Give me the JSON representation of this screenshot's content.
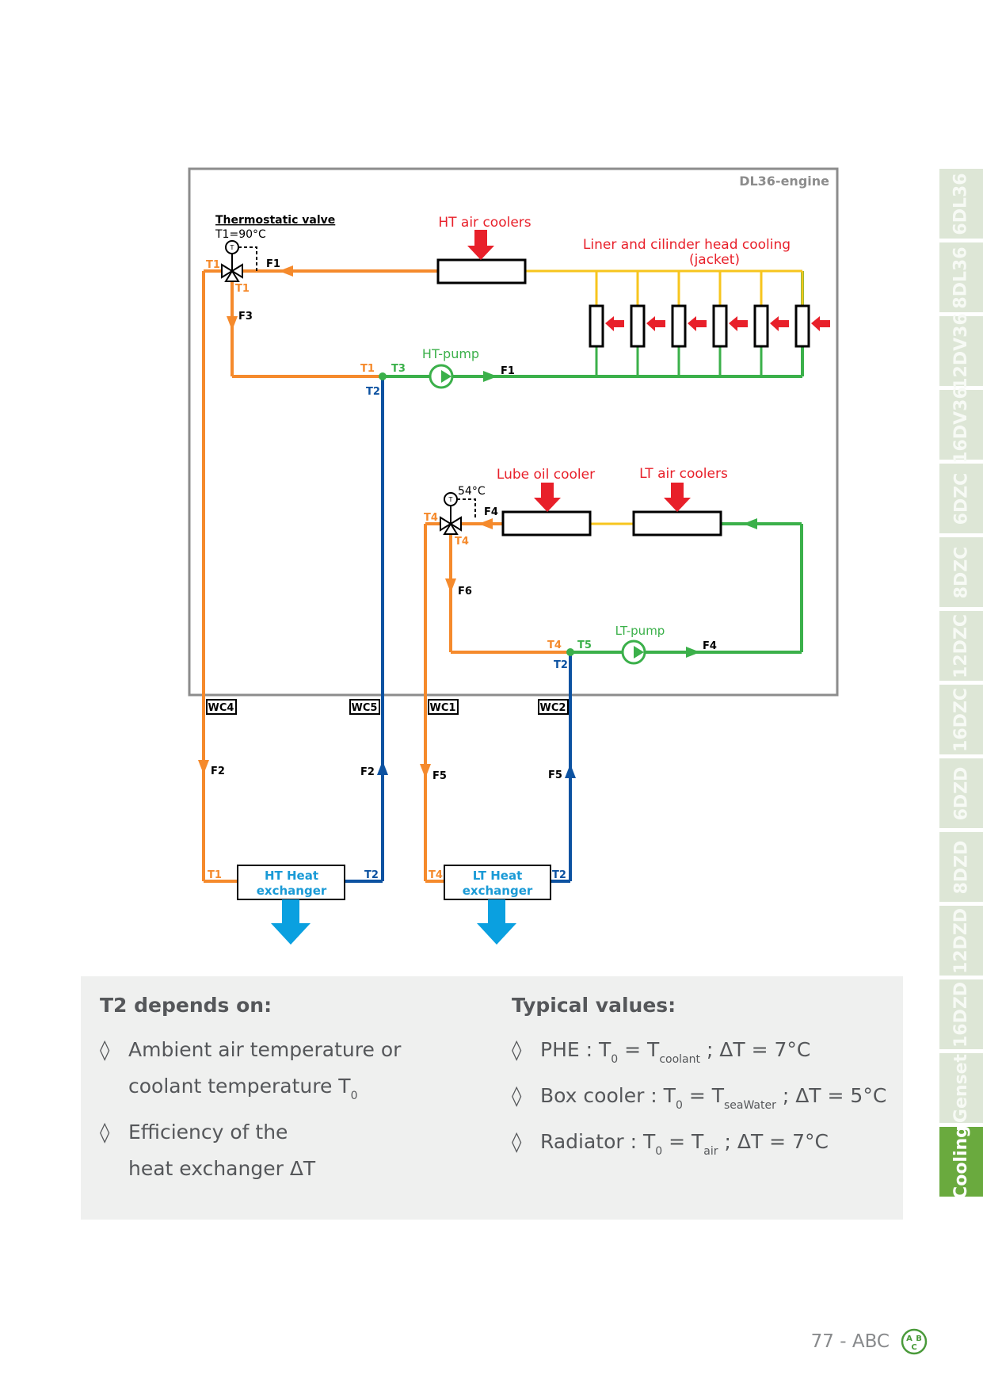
{
  "diagram": {
    "engine_label": "DL36-engine",
    "ht_circuit": {
      "thermostatic_valve_title": "Thermostatic valve",
      "thermostatic_valve_setpoint": "T1=90°C",
      "sensor_symbol": "T",
      "ht_air_coolers": "HT air coolers",
      "jacket_title": "Liner and cilinder head cooling",
      "jacket_subtitle": "(jacket)",
      "jacket_cylinder_count": 6,
      "pump_label": "HT-pump",
      "labels": {
        "t1_valve_left": "T1",
        "t1_valve_bottom": "T1",
        "f1_valve": "F1",
        "f3": "F3",
        "t1_junction": "T1",
        "t3": "T3",
        "t2_junction": "T2",
        "f1_pump": "F1"
      }
    },
    "lt_circuit": {
      "valve_setpoint": "54°C",
      "sensor_symbol": "T",
      "lube_oil_cooler": "Lube oil cooler",
      "lt_air_coolers": "LT air coolers",
      "pump_label": "LT-pump",
      "labels": {
        "t4_valve_left": "T4",
        "t4_valve_bottom": "T4",
        "f4_valve": "F4",
        "f6": "F6",
        "t4_junction": "T4",
        "t5": "T5",
        "t2_junction": "T2",
        "f4_pump": "F4"
      }
    },
    "connections": [
      "WC4",
      "WC5",
      "WC1",
      "WC2"
    ],
    "external": {
      "f2_out": "F2",
      "f2_in": "F2",
      "f5_out": "F5",
      "f5_in": "F5",
      "ht_hx_title": "HT Heat",
      "ht_hx_subtitle": "exchanger",
      "ht_hx_t1": "T1",
      "ht_hx_t2": "T2",
      "lt_hx_title": "LT Heat",
      "lt_hx_subtitle": "exchanger",
      "lt_hx_t4": "T4",
      "lt_hx_t2": "T2"
    },
    "colors": {
      "hot": "#f58a2c",
      "cold": "#0c52a1",
      "warm": "#f7c51e",
      "return": "#3bb04a",
      "heat_arrow": "#e8202a",
      "exchanger_arrow": "#0aa0e0",
      "engine_box": "#8c8c8c",
      "label_red": "#e8202a",
      "label_green": "#3bb04a",
      "label_blue": "#1a9ad6"
    }
  },
  "sidebar": {
    "tabs": [
      {
        "label": "6DL36",
        "active": false
      },
      {
        "label": "8DL36",
        "active": false
      },
      {
        "label": "12DV36",
        "active": false
      },
      {
        "label": "16DV36",
        "active": false
      },
      {
        "label": "6DZC",
        "active": false
      },
      {
        "label": "8DZC",
        "active": false
      },
      {
        "label": "12DZC",
        "active": false
      },
      {
        "label": "16DZC",
        "active": false
      },
      {
        "label": "6DZD",
        "active": false
      },
      {
        "label": "8DZD",
        "active": false
      },
      {
        "label": "12DZD",
        "active": false
      },
      {
        "label": "16DZD",
        "active": false
      },
      {
        "label": "Genset",
        "active": false
      },
      {
        "label": "Cooling",
        "active": true
      }
    ]
  },
  "info": {
    "left": {
      "title": "T2 depends on:",
      "bullet": "◊",
      "item1_line1": "Ambient air temperature or",
      "item1_line2": "coolant temperature T",
      "item1_sub": "0",
      "item2_line1": "Efficiency of the",
      "item2_line2": "heat exchanger ΔT"
    },
    "right": {
      "title": "Typical values:",
      "bullet": "◊",
      "rows": [
        {
          "name": "PHE : T",
          "sub0": "0",
          "eq": "= T",
          "sub": "coolant",
          "tail": "; ΔT = 7°C"
        },
        {
          "name": "Box cooler : T",
          "sub0": "0",
          "eq": "= T",
          "sub": "seaWater",
          "tail": "; ΔT = 5°C"
        },
        {
          "name": "Radiator : T",
          "sub0": "0",
          "eq": "= T",
          "sub": "air",
          "tail": "; ΔT = 7°C"
        }
      ]
    }
  },
  "footer": {
    "page": "77 - ABC",
    "logo_letters": [
      "A",
      "B",
      "C"
    ]
  }
}
